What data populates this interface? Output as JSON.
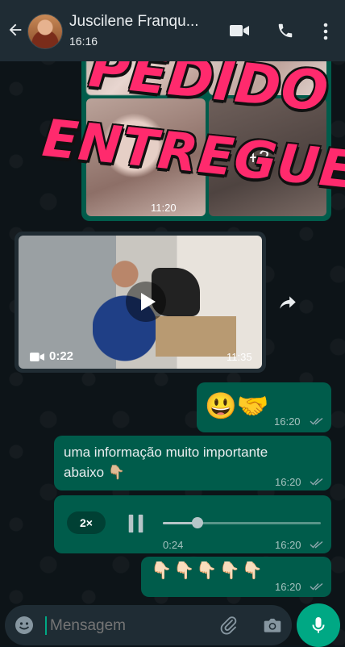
{
  "header": {
    "contact_name": "Juscilene Franqu...",
    "last_seen": "16:16"
  },
  "overlay": {
    "line1": "PEDIDO",
    "line2": "ENTREGUE"
  },
  "messages": {
    "album": {
      "extra_count": "+2",
      "time": "11:20"
    },
    "video": {
      "duration": "0:22",
      "time": "11:35"
    },
    "emoji_msg": {
      "text": "😃🤝",
      "time": "16:20"
    },
    "text_msg": {
      "text": "uma informação muito importante abaixo 👇🏼",
      "time": "16:20"
    },
    "audio_msg": {
      "speed": "2×",
      "elapsed": "0:24",
      "progress": 0.22,
      "time": "16:20"
    },
    "pointing_msg": {
      "text": "👇🏻👇🏻👇🏻👇🏻👇🏻",
      "time": "16:20"
    }
  },
  "composer": {
    "placeholder": "Mensagem"
  },
  "colors": {
    "header_bg": "#1f2c34",
    "outgoing_bubble": "#005c4b",
    "accent": "#00a884",
    "overlay_text": "#ff2a6d"
  },
  "icons": [
    "back-arrow-icon",
    "video-call-icon",
    "phone-icon",
    "more-icon",
    "play-icon",
    "forward-icon",
    "video-camera-icon",
    "pause-icon",
    "emoji-icon",
    "attach-icon",
    "camera-icon",
    "mic-icon",
    "double-check-icon"
  ]
}
